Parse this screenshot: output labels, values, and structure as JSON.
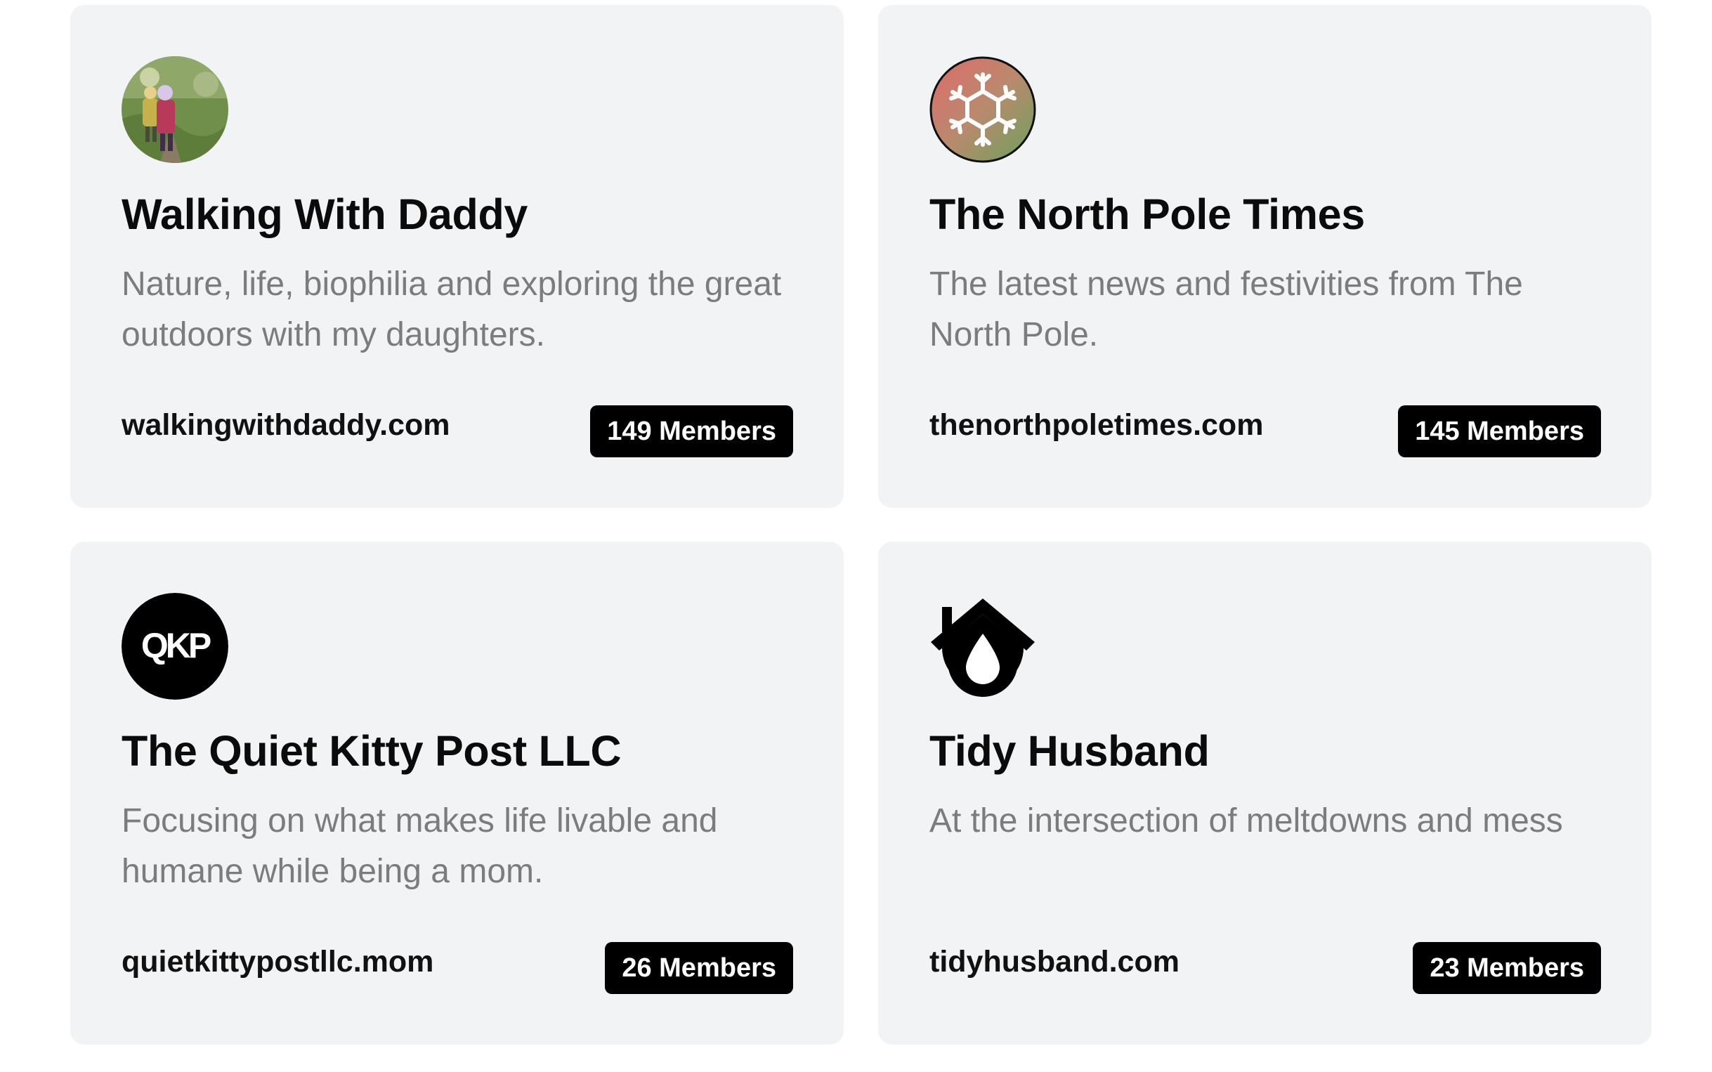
{
  "colors": {
    "card_background": "#f2f3f5",
    "badge_background": "#000000",
    "badge_text": "#ffffff",
    "title_text": "#0b0b0b",
    "description_text": "#7c7c7c"
  },
  "publications": [
    {
      "avatar_icon": "hiking-photo-avatar",
      "title": "Walking With Daddy",
      "description": "Nature, life, biophilia and exploring the great outdoors with my daughters.",
      "domain": "walkingwithdaddy.com",
      "members": "149 Members"
    },
    {
      "avatar_icon": "snowflake-icon",
      "title": "The North Pole Times",
      "description": "The latest news and festivities from The North Pole.",
      "domain": "thenorthpoletimes.com",
      "members": "145 Members"
    },
    {
      "avatar_icon": "qkp-logo",
      "avatar_text": "QKP",
      "title": "The Quiet Kitty Post LLC",
      "description": "Focusing on what makes life livable and humane while being a mom.",
      "domain": "quietkittypostllc.mom",
      "members": "26 Members"
    },
    {
      "avatar_icon": "house-droplet-icon",
      "title": "Tidy Husband",
      "description": "At the intersection of meltdowns and mess",
      "domain": "tidyhusband.com",
      "members": "23 Members"
    }
  ]
}
